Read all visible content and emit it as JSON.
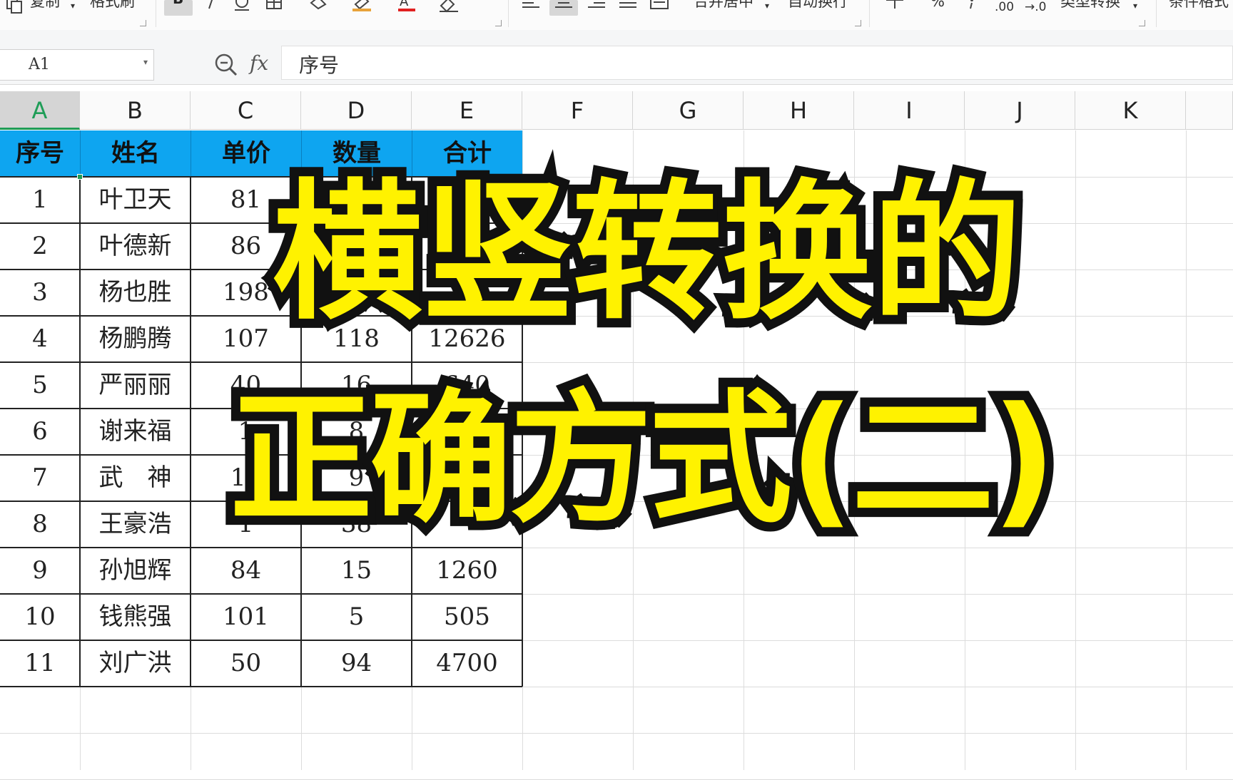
{
  "toolbar": {
    "copy_label": "复制",
    "format_painter_label": "格式刷",
    "merge_center_label": "合并居中",
    "wrap_text_label": "自动换行",
    "type_convert_label": "类型转换",
    "conditional_format_label": "条件格式",
    "percent_label": "%",
    "dec_inc_label": ".00",
    "dec_dec_label": "→.0",
    "dropdown_caret": "▾"
  },
  "formula_bar": {
    "name_box": "A1",
    "name_box_caret": "▾",
    "fx_label": "fx",
    "formula": "序号"
  },
  "columns": [
    "A",
    "B",
    "C",
    "D",
    "E",
    "F",
    "G",
    "H",
    "I",
    "J",
    "K"
  ],
  "selected_column": "A",
  "table": {
    "headers": [
      "序号",
      "姓名",
      "单价",
      "数量",
      "合计"
    ],
    "header_color": "#0ea5f0",
    "rows": [
      [
        "1",
        "叶卫天",
        "81",
        "",
        ""
      ],
      [
        "2",
        "叶德新",
        "86",
        "",
        ""
      ],
      [
        "3",
        "杨也胜",
        "198",
        "",
        ""
      ],
      [
        "4",
        "杨鹏腾",
        "107",
        "118",
        "12626"
      ],
      [
        "5",
        "严丽丽",
        "40",
        "16",
        "640"
      ],
      [
        "6",
        "谢来福",
        "1",
        "8",
        ""
      ],
      [
        "7",
        "武　神",
        "17",
        "9",
        ""
      ],
      [
        "8",
        "王豪浩",
        "1",
        "38",
        ""
      ],
      [
        "9",
        "孙旭辉",
        "84",
        "15",
        "1260"
      ],
      [
        "10",
        "钱熊强",
        "101",
        "5",
        "505"
      ],
      [
        "11",
        "刘广洪",
        "50",
        "94",
        "4700"
      ]
    ]
  },
  "overlay": {
    "line1": "横竖转换的",
    "line2": "正确方式(二)",
    "fill_color": "#fff200",
    "stroke_color": "#111111"
  }
}
